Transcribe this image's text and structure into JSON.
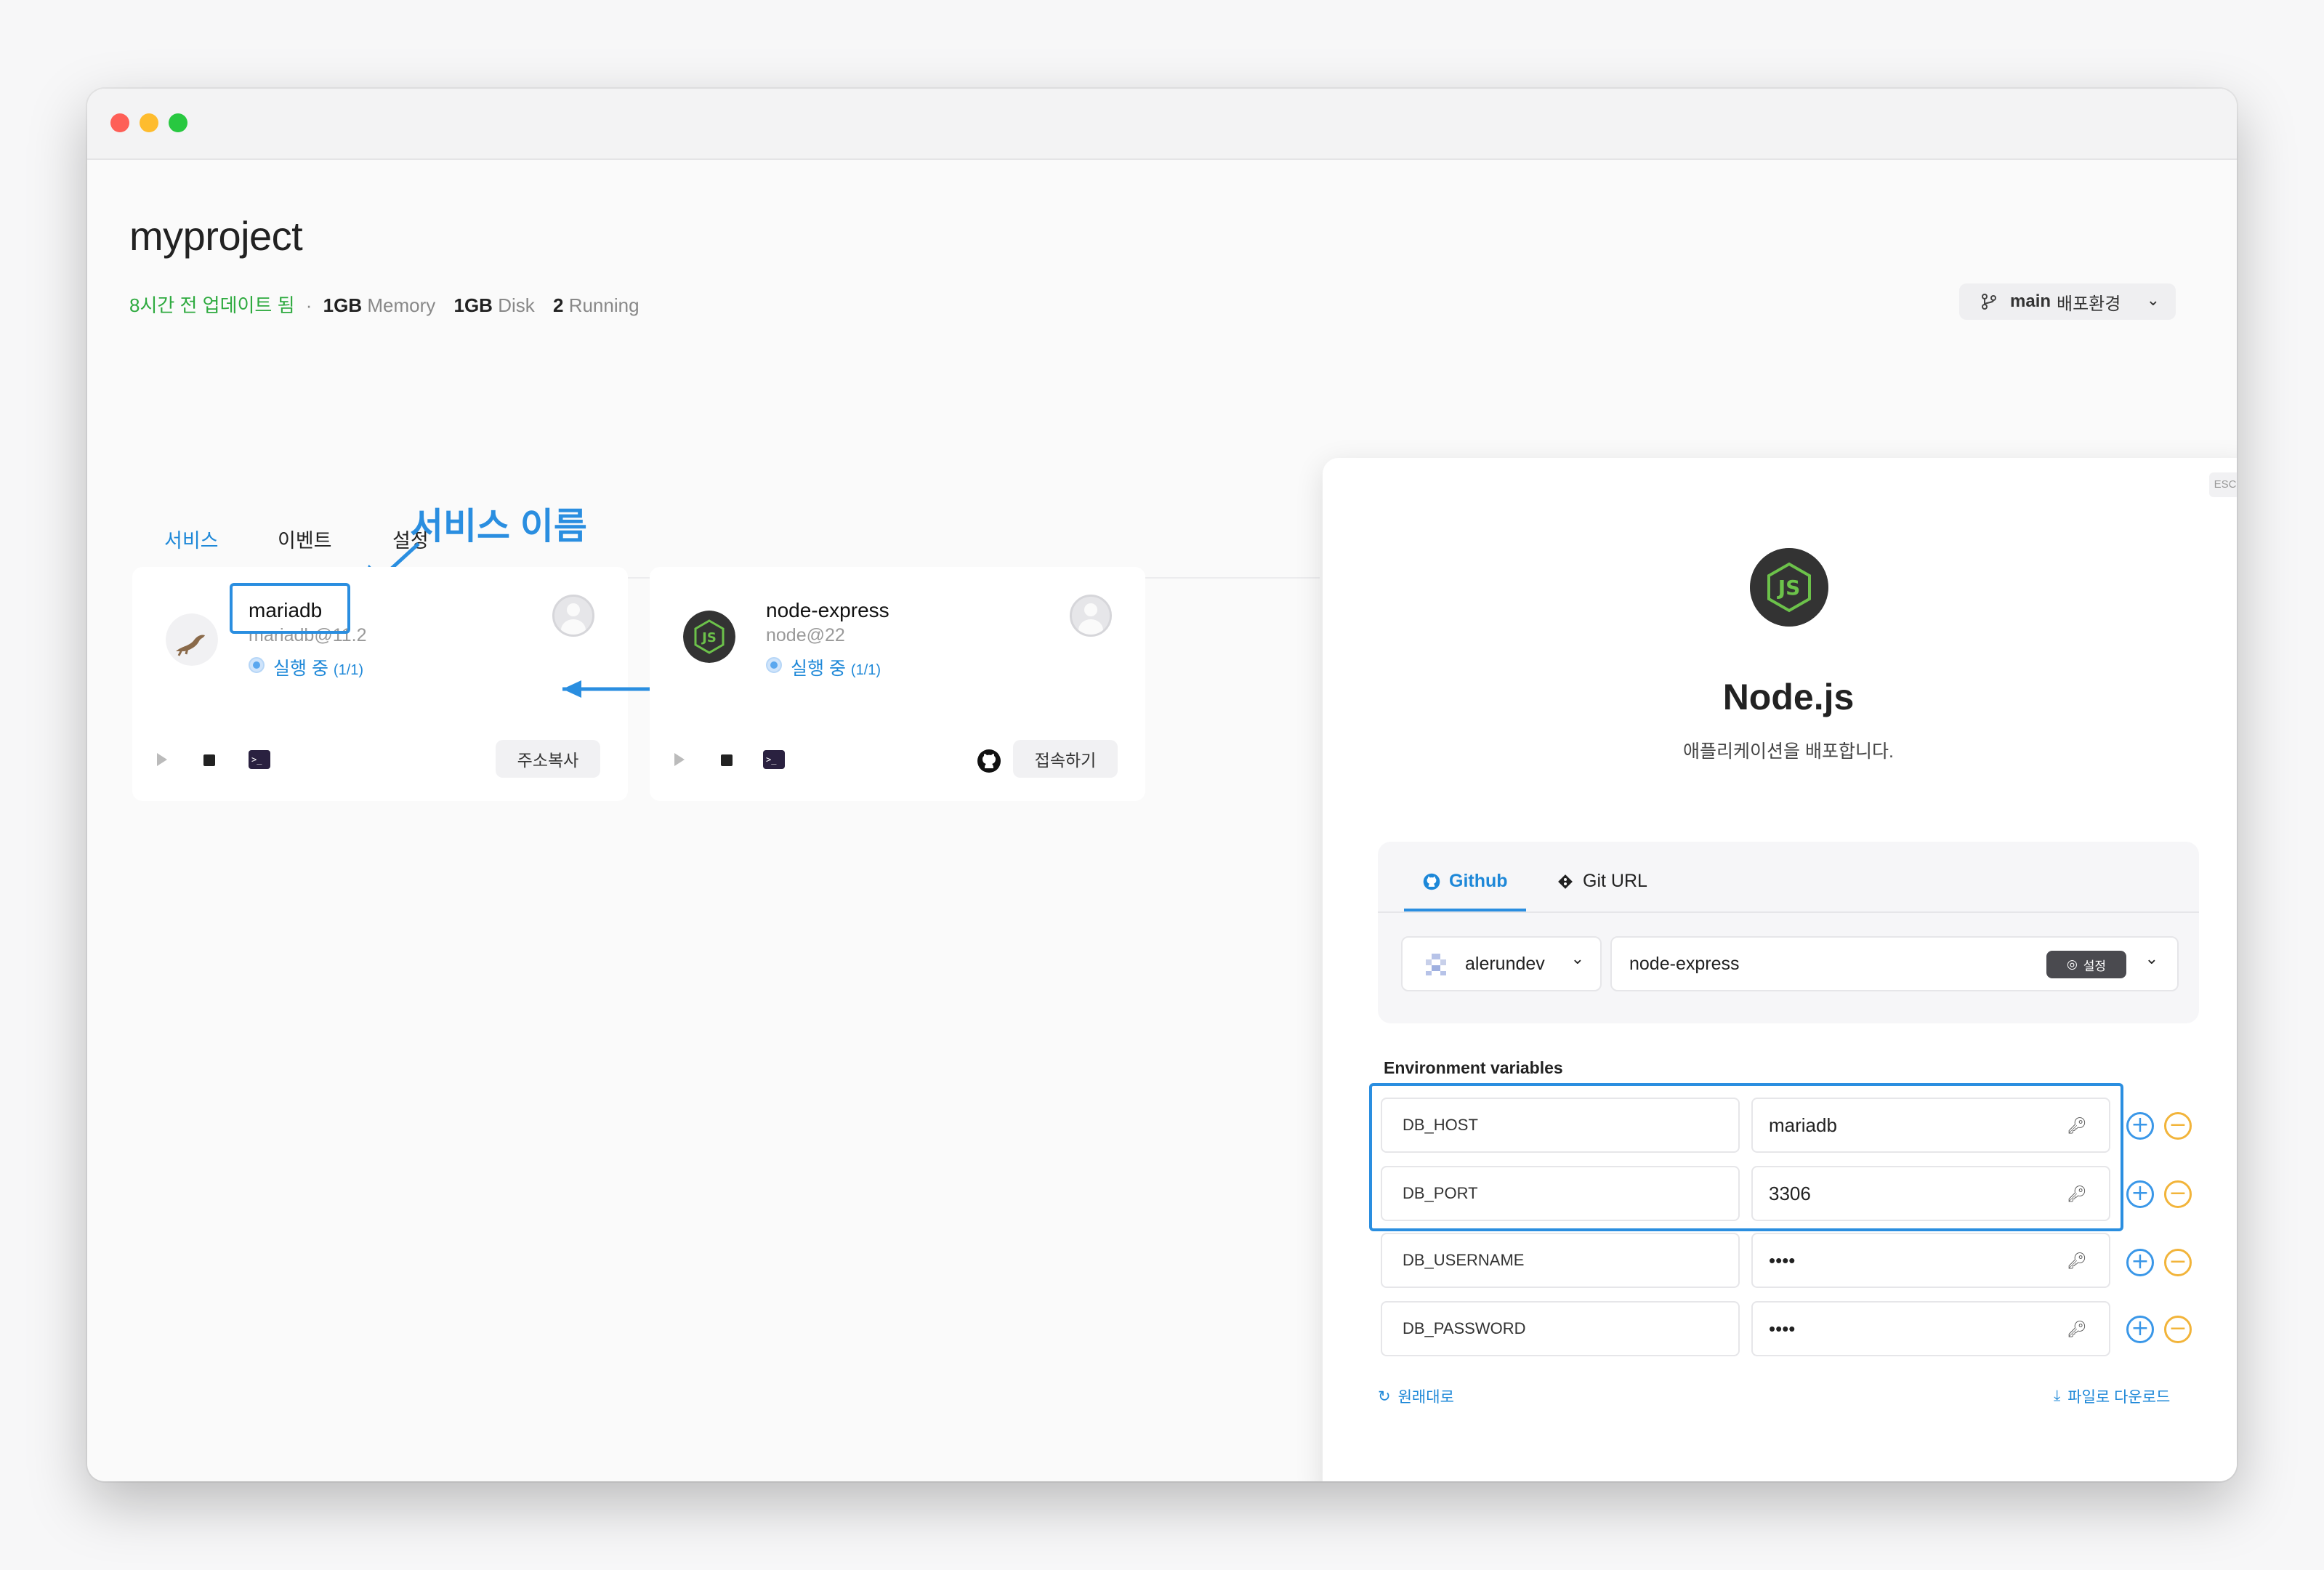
{
  "project": {
    "title": "myproject",
    "updated": "8시간 전 업데이트 됨",
    "separator": "·",
    "memory_value": "1GB",
    "memory_label": "Memory",
    "disk_value": "1GB",
    "disk_label": "Disk",
    "running_value": "2",
    "running_label": "Running"
  },
  "branch": {
    "name": "main",
    "label": "배포환경"
  },
  "tabs": [
    {
      "label": "서비스",
      "active": true
    },
    {
      "label": "이벤트",
      "active": false
    },
    {
      "label": "설정",
      "active": false
    }
  ],
  "annotation": {
    "label": "서비스 이름"
  },
  "services": [
    {
      "name": "mariadb",
      "version": "mariadb@11.2",
      "status": "실행 중",
      "status_count": "(1/1)",
      "action": "주소복사",
      "logo": "mariadb-seal-icon"
    },
    {
      "name": "node-express",
      "version": "node@22",
      "status": "실행 중",
      "status_count": "(1/1)",
      "action": "접속하기",
      "logo": "nodejs-icon"
    }
  ],
  "modal": {
    "esc": "ESC",
    "title": "Node.js",
    "subtitle": "애플리케이션을 배포합니다.",
    "source_tabs": [
      {
        "label": "Github",
        "active": true
      },
      {
        "label": "Git URL",
        "active": false
      }
    ],
    "account": "alerundev",
    "repository": "node-express",
    "settings_badge": "설정",
    "env_title": "Environment variables",
    "env": [
      {
        "key": "DB_HOST",
        "value": "mariadb"
      },
      {
        "key": "DB_PORT",
        "value": "3306"
      },
      {
        "key": "DB_USERNAME",
        "value": "••••"
      },
      {
        "key": "DB_PASSWORD",
        "value": "••••"
      }
    ],
    "reset_label": "원래대로",
    "download_label": "파일로 다운로드"
  },
  "colors": {
    "accent": "#2a8ee0",
    "running_green": "#2eaa3f",
    "minus_orange": "#f2b43a"
  }
}
